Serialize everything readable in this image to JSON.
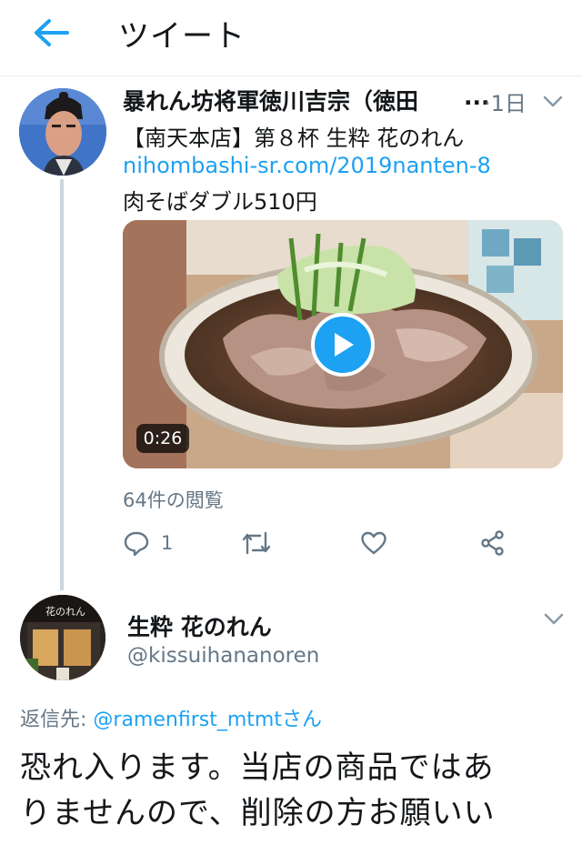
{
  "header": {
    "title": "ツイート",
    "back_icon": "arrow-left-icon"
  },
  "colors": {
    "accent": "#1da1f2",
    "secondary_text": "#657786",
    "primary_text": "#14171a",
    "divider": "#e6ecf0"
  },
  "tweet": {
    "author_name": "暴れん坊将軍徳川吉宗（徳田",
    "author_name_ellipsis": "...",
    "time": "·1日",
    "title_line": "【南天本店】第８杯 生粋 花のれん",
    "link": "nihombashi-sr.com/2019nanten-8",
    "menu_line": "肉そばダブル510円",
    "video": {
      "duration": "0:26",
      "play_icon": "play-icon"
    },
    "views": "64件の閲覧",
    "actions": {
      "reply_count": "1",
      "reply_icon": "reply-icon",
      "retweet_icon": "retweet-icon",
      "like_icon": "heart-icon",
      "share_icon": "share-icon"
    }
  },
  "reply": {
    "author_name": "生粋 花のれん",
    "handle": "@kissuihananoren",
    "reply_to_label": "返信先: ",
    "reply_to_mention": "@ramenfirst_mtmtさん",
    "text_line1": "恐れ入ります。当店の商品ではあ",
    "text_line2": "りませんので、削除の方お願いい",
    "avatar_sign": "花のれん"
  }
}
